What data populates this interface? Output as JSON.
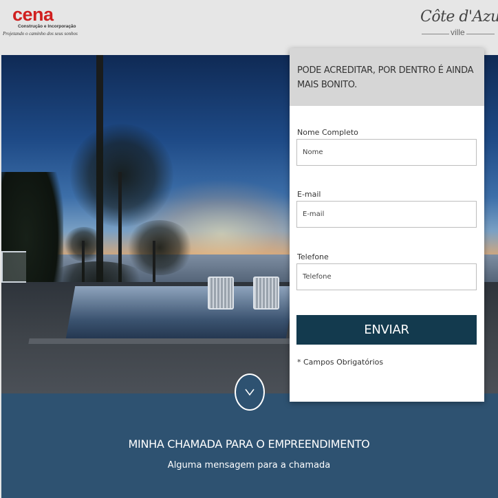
{
  "header": {
    "logo_left": {
      "name": "cena",
      "tagline": "Construção e Incorporação",
      "slogan": "Projetando o caminho dos seus sonhos"
    },
    "logo_right": {
      "name": "Côte d'Azur",
      "sub": "ville"
    }
  },
  "hero": {
    "image": "sunset-pool-photo"
  },
  "form": {
    "heading": "PODE ACREDITAR, POR DENTRO É AINDA MAIS BONITO.",
    "fields": [
      {
        "label": "Nome Completo",
        "placeholder": "Nome",
        "value": ""
      },
      {
        "label": "E-mail",
        "placeholder": "E-mail",
        "value": ""
      },
      {
        "label": "Telefone",
        "placeholder": "Telefone",
        "value": ""
      }
    ],
    "submit_label": "ENVIAR",
    "required_note": "* Campos Obrigatórios"
  },
  "scroll": {
    "icon": "chevron-down-icon"
  },
  "band": {
    "title": "MINHA CHAMADA PARA O EMPREENDIMENTO",
    "subtitle": "Alguma mensagem para a chamada"
  },
  "colors": {
    "brand_red": "#d01f1f",
    "band_blue": "#2e5271",
    "button_navy": "#133a4e",
    "header_bg": "#e6e6e6",
    "card_head_bg": "#d6d6d6"
  }
}
